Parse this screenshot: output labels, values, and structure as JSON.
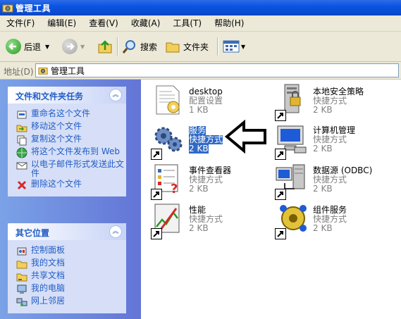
{
  "window": {
    "title": "管理工具"
  },
  "menu": [
    "文件(F)",
    "编辑(E)",
    "查看(V)",
    "收藏(A)",
    "工具(T)",
    "帮助(H)"
  ],
  "toolbar": {
    "back_label": "后退",
    "search_label": "搜索",
    "folders_label": "文件夹"
  },
  "address": {
    "label": "地址(D)",
    "value": "管理工具"
  },
  "tasks_panel": {
    "title": "文件和文件夹任务",
    "items": [
      "重命名这个文件",
      "移动这个文件",
      "复制这个文件",
      "将这个文件发布到 Web",
      "以电子邮件形式发送此文件",
      "删除这个文件"
    ]
  },
  "places_panel": {
    "title": "其它位置",
    "items": [
      "控制面板",
      "我的文档",
      "共享文档",
      "我的电脑",
      "网上邻居"
    ]
  },
  "files": [
    {
      "name": "desktop",
      "type": "配置设置",
      "size": "1 KB",
      "icon": "config-file-icon",
      "selected": false
    },
    {
      "name": "本地安全策略",
      "type": "快捷方式",
      "size": "2 KB",
      "icon": "security-policy-icon",
      "selected": false
    },
    {
      "name": "服务",
      "type": "快捷方式",
      "size": "2 KB",
      "icon": "services-gears-icon",
      "selected": true
    },
    {
      "name": "计算机管理",
      "type": "快捷方式",
      "size": "2 KB",
      "icon": "computer-management-icon",
      "selected": false
    },
    {
      "name": "事件查看器",
      "type": "快捷方式",
      "size": "2 KB",
      "icon": "event-viewer-icon",
      "selected": false
    },
    {
      "name": "数据源 (ODBC)",
      "type": "快捷方式",
      "size": "2 KB",
      "icon": "odbc-icon",
      "selected": false
    },
    {
      "name": "性能",
      "type": "快捷方式",
      "size": "2 KB",
      "icon": "performance-icon",
      "selected": false
    },
    {
      "name": "组件服务",
      "type": "快捷方式",
      "size": "2 KB",
      "icon": "component-services-icon",
      "selected": false
    }
  ],
  "colors": {
    "titlebar": "#0a54e3",
    "task_link": "#215dc6",
    "selection": "#316ac5",
    "chrome": "#ece9d8"
  }
}
